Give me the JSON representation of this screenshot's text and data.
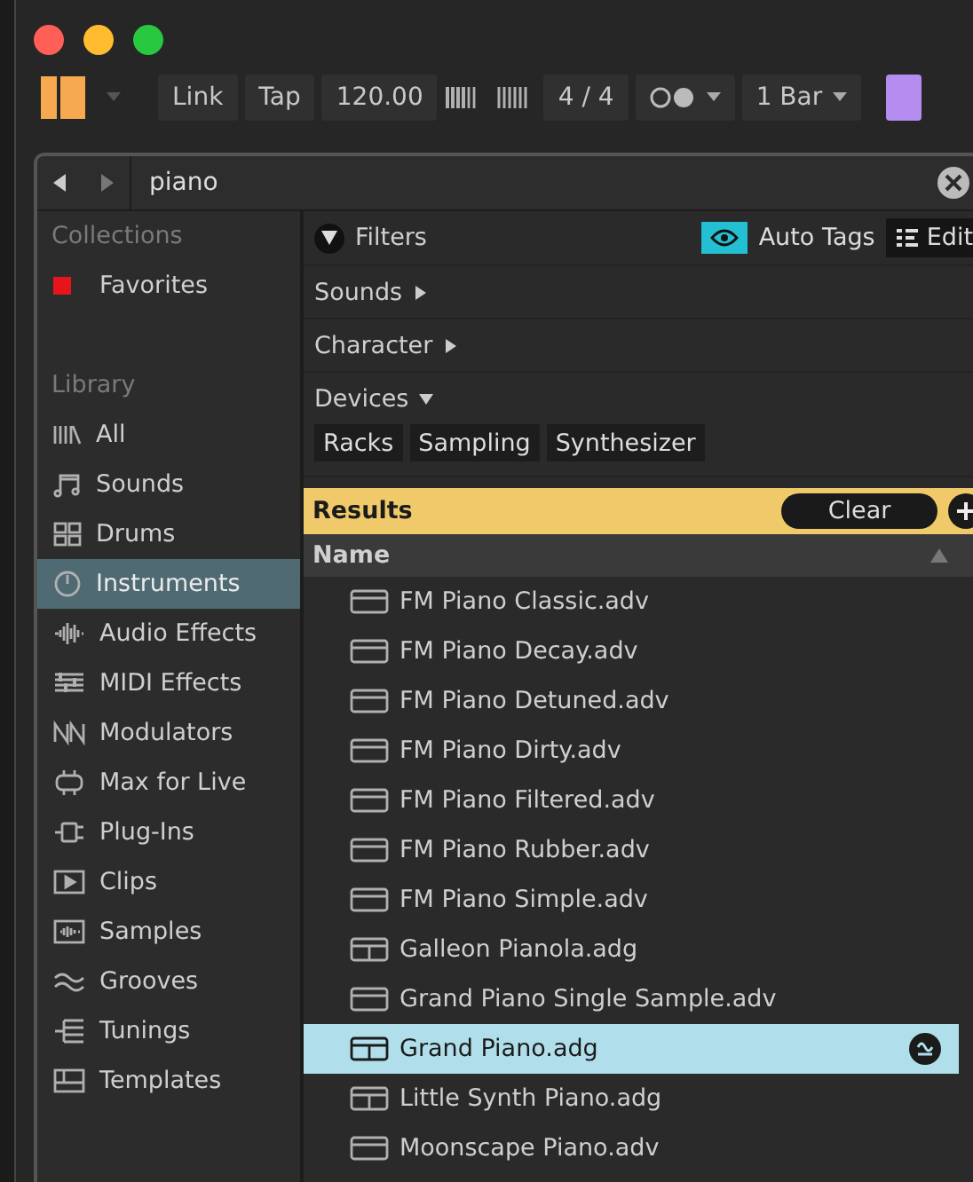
{
  "toolbar": {
    "buttons": [
      {
        "label": "Link"
      },
      {
        "label": "Tap"
      },
      {
        "label": "120.00"
      }
    ],
    "signature": "4 / 4",
    "quantize": "1 Bar"
  },
  "search": {
    "value": "piano"
  },
  "sidebar": {
    "collections_heading": "Collections",
    "collections": [
      {
        "label": "Favorites",
        "color": "#e8141c"
      }
    ],
    "library_heading": "Library",
    "items": [
      {
        "label": "All",
        "kind": "all",
        "selected": false
      },
      {
        "label": "Sounds",
        "kind": "sounds",
        "selected": false
      },
      {
        "label": "Drums",
        "kind": "drums",
        "selected": false
      },
      {
        "label": "Instruments",
        "kind": "instruments",
        "selected": true
      },
      {
        "label": "Audio Effects",
        "kind": "audio",
        "selected": false
      },
      {
        "label": "MIDI Effects",
        "kind": "midi",
        "selected": false
      },
      {
        "label": "Modulators",
        "kind": "modulators",
        "selected": false
      },
      {
        "label": "Max for Live",
        "kind": "max",
        "selected": false
      },
      {
        "label": "Plug-Ins",
        "kind": "plugins",
        "selected": false
      },
      {
        "label": "Clips",
        "kind": "clips",
        "selected": false
      },
      {
        "label": "Samples",
        "kind": "samples",
        "selected": false
      },
      {
        "label": "Grooves",
        "kind": "grooves",
        "selected": false
      },
      {
        "label": "Tunings",
        "kind": "tunings",
        "selected": false
      },
      {
        "label": "Templates",
        "kind": "templates",
        "selected": false
      }
    ]
  },
  "filters": {
    "title": "Filters",
    "auto_tags": {
      "label": "Auto Tags",
      "on": true
    },
    "edit": "Edit",
    "groups": [
      {
        "label": "Sounds",
        "expanded": false
      },
      {
        "label": "Character",
        "expanded": false
      },
      {
        "label": "Devices",
        "expanded": true,
        "tags": [
          "Racks",
          "Sampling",
          "Synthesizer"
        ]
      }
    ]
  },
  "results": {
    "title": "Results",
    "clear": "Clear",
    "column": "Name",
    "rows": [
      {
        "name": "FM Piano Classic.adv",
        "kind": "preset",
        "selected": false
      },
      {
        "name": "FM Piano Decay.adv",
        "kind": "preset",
        "selected": false
      },
      {
        "name": "FM Piano Detuned.adv",
        "kind": "preset",
        "selected": false
      },
      {
        "name": "FM Piano Dirty.adv",
        "kind": "preset",
        "selected": false
      },
      {
        "name": "FM Piano Filtered.adv",
        "kind": "preset",
        "selected": false
      },
      {
        "name": "FM Piano Rubber.adv",
        "kind": "preset",
        "selected": false
      },
      {
        "name": "FM Piano Simple.adv",
        "kind": "preset",
        "selected": false
      },
      {
        "name": "Galleon Pianola.adg",
        "kind": "rack",
        "selected": false
      },
      {
        "name": "Grand Piano Single Sample.adv",
        "kind": "preset",
        "selected": false
      },
      {
        "name": "Grand Piano.adg",
        "kind": "rack",
        "selected": true
      },
      {
        "name": "Little Synth Piano.adg",
        "kind": "rack",
        "selected": false
      },
      {
        "name": "Moonscape Piano.adv",
        "kind": "preset",
        "selected": false
      }
    ]
  }
}
